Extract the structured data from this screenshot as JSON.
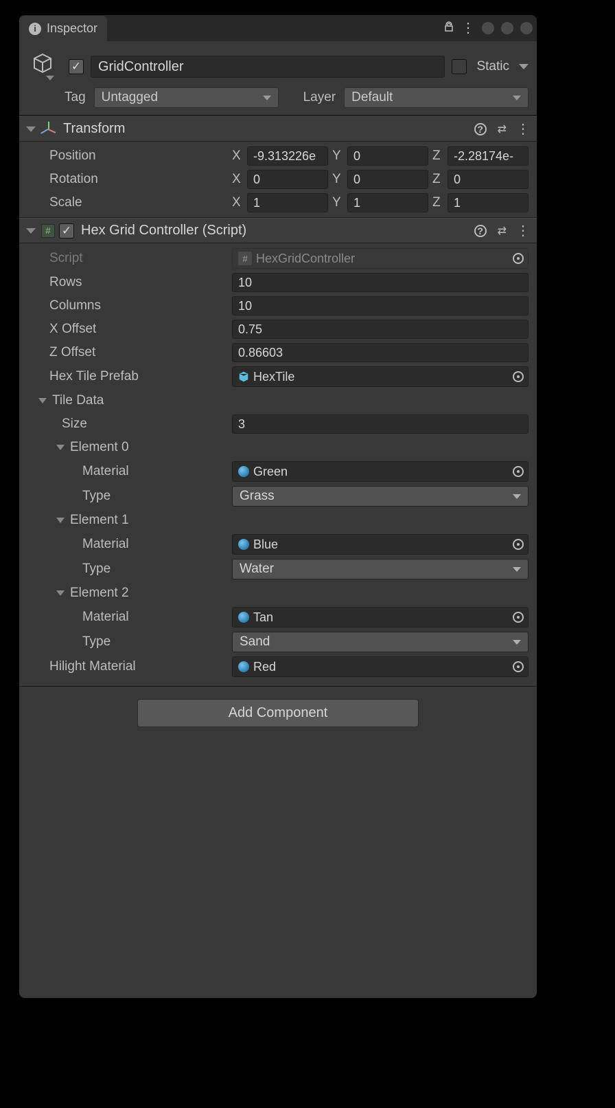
{
  "tab": {
    "title": "Inspector"
  },
  "header": {
    "name": "GridController",
    "enabled": true,
    "static_label": "Static",
    "static_value": false,
    "tag_label": "Tag",
    "tag_value": "Untagged",
    "layer_label": "Layer",
    "layer_value": "Default"
  },
  "transform": {
    "title": "Transform",
    "rows": {
      "position": {
        "label": "Position",
        "x": "-9.313226e",
        "y": "0",
        "z": "-2.28174e-"
      },
      "rotation": {
        "label": "Rotation",
        "x": "0",
        "y": "0",
        "z": "0"
      },
      "scale": {
        "label": "Scale",
        "x": "1",
        "y": "1",
        "z": "1"
      }
    },
    "axis": {
      "x": "X",
      "y": "Y",
      "z": "Z"
    }
  },
  "script_comp": {
    "title": "Hex Grid Controller (Script)",
    "enabled": true,
    "fields": {
      "script_label": "Script",
      "script_value": "HexGridController",
      "rows_label": "Rows",
      "rows_value": "10",
      "cols_label": "Columns",
      "cols_value": "10",
      "xoff_label": "X Offset",
      "xoff_value": "0.75",
      "zoff_label": "Z Offset",
      "zoff_value": "0.86603",
      "prefab_label": "Hex Tile Prefab",
      "prefab_value": "HexTile",
      "tiledata_label": "Tile Data",
      "size_label": "Size",
      "size_value": "3",
      "mat_label": "Material",
      "type_label": "Type",
      "hilite_label": "Hilight Material",
      "hilite_value": "Red"
    },
    "elements": [
      {
        "label": "Element 0",
        "material": "Green",
        "type": "Grass"
      },
      {
        "label": "Element 1",
        "material": "Blue",
        "type": "Water"
      },
      {
        "label": "Element 2",
        "material": "Tan",
        "type": "Sand"
      }
    ]
  },
  "add_component": "Add Component"
}
